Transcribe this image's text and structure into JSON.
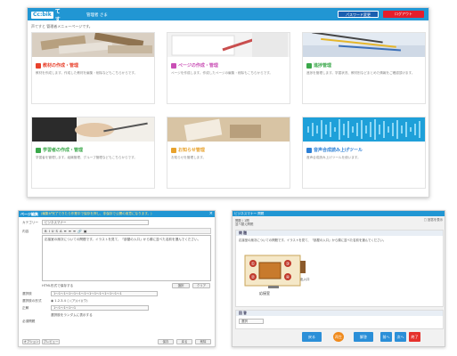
{
  "dashboard": {
    "logo_box": "Cc:bik",
    "logo_text": "声てすと",
    "admin_label": "管理者 さま",
    "password_button": "パスワード変更",
    "logout_button": "ログアウト",
    "intro": "声てすと 管理者メニューページです。",
    "cards": [
      {
        "title": "教材の作成・管理",
        "desc": "教材を作成します。作成した教材を編集・削除などもこちらからです。",
        "color": "#e8412c",
        "icon": "document-icon"
      },
      {
        "title": "ページの作成・管理",
        "desc": "ページを作成します。作成したページの編集・削除もこちらからです。",
        "color": "#c94fb5",
        "icon": "page-icon"
      },
      {
        "title": "進捗管理",
        "desc": "進捗を管理します。学習状況、教材別などまとめた情報をご確認頂けます。",
        "color": "#3aa84a",
        "icon": "chart-icon"
      },
      {
        "title": "学習者の作成・管理",
        "desc": "学習者を管理します。組織管理、グループ管理などもこちらからです。",
        "color": "#3aa84a",
        "icon": "user-icon"
      },
      {
        "title": "お知らせ管理",
        "desc": "お知らせを管理します。",
        "color": "#e8a22c",
        "icon": "bell-icon"
      },
      {
        "title": "音声合成読み上げツール",
        "desc": "音声合成読み上げツールを使います。",
        "color": "#2b7fd6",
        "icon": "wave-icon"
      }
    ]
  },
  "editor": {
    "title": "ページ編集",
    "subtitle": "(編集が完了できたら作業中で保存を押し、非保存で公開の用意になります。)",
    "category_label": "カテゴリー",
    "category_value": "ビジネスマナー",
    "content_label": "内容",
    "toolbar": [
      "B",
      "I",
      "U",
      "S",
      "A",
      "≡",
      "≡",
      "≡",
      "🔗",
      "▣"
    ],
    "content_text": "応接室の席次についての問題です。イラストを見て、「部屋の入口」から順に並べた名前を選んでください。",
    "html_label": "HTML形式で保存する",
    "btn_a": "選択",
    "btn_b": "クリア",
    "choices_label": "選択肢",
    "choices_value": "1〜1〜1〜1〜1〜1〜1〜1〜1〜1〜1〜1〜1〜1",
    "format_label": "選択肢の形式",
    "format_value": "◉ 1.2.3.4  ○ (ア)(イ)(ウ)",
    "answer_label": "正解",
    "answer_value": "1〜1〜1〜1〜1",
    "random_label": "選択肢をランダムに表示する",
    "required_label": "必須問題",
    "footer_left": "オプション",
    "footer_left2": "プレビュー",
    "footer_r1": "保存",
    "footer_r2": "戻る",
    "footer_r3": "削除"
  },
  "viewer": {
    "title": "ビジネスマナー 問題",
    "checkbox": "□ 回答を表示",
    "meta1": "問題 / 1問",
    "meta2": "並べ替え問題",
    "q_heading": "問 題",
    "q_text": "応接室の席次についての問題です。イラストを見て、「部屋の入口」から順に並べた名前を選んでください。",
    "room_label": "応接室",
    "door_label": "出入口",
    "a_heading": "回 答",
    "answer_select": "選択",
    "btn_prev": "戻る",
    "btn_play": "再生",
    "btn_check": "解答",
    "btn_i1": "前へ",
    "btn_i2": "次へ",
    "btn_i3": "終了",
    "colors": {
      "blue": "#2b8fd8",
      "orange": "#f08a1c",
      "red": "#e5312c"
    }
  }
}
